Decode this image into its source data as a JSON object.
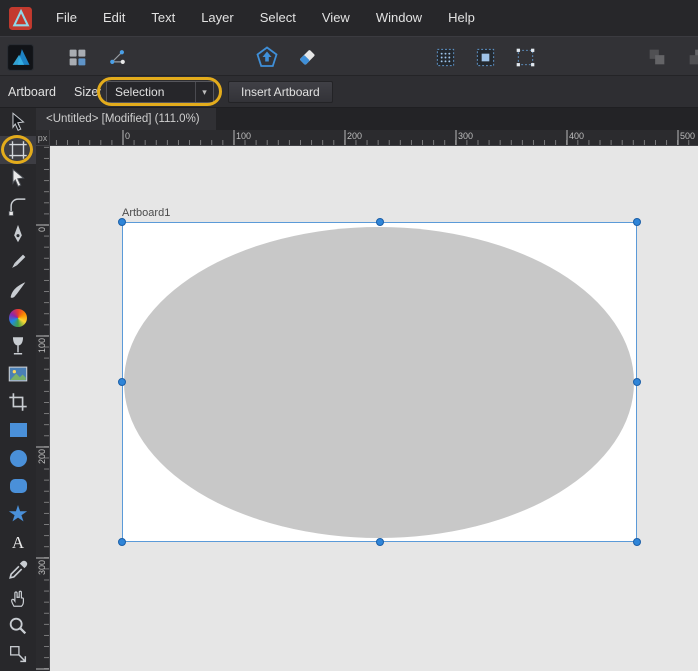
{
  "menu_bar": {
    "items": [
      "File",
      "Edit",
      "Text",
      "Layer",
      "Select",
      "View",
      "Window",
      "Help"
    ]
  },
  "toolbar": {
    "left_icons": [
      "grid-icon",
      "node-connections-icon"
    ],
    "logo_icon": "affinity-designer-logo",
    "center_icons": [
      "pentagon-upload-icon",
      "eraser-icon"
    ],
    "right_icons": [
      "snap-dots-icon",
      "snap-squares-icon",
      "snap-transform-icon"
    ],
    "far_right_disabled_icons": [
      "arrange-icon-1",
      "arrange-icon-2"
    ]
  },
  "context_toolbar": {
    "tool_label": "Artboard",
    "size_label": "Size:",
    "size_value": "Selection",
    "caret": "▼",
    "insert_artboard_label": "Insert Artboard"
  },
  "document": {
    "tab_title": "<Untitled> [Modified] (111.0%)",
    "artboard_name": "Artboard1"
  },
  "rulers": {
    "unit_label": "px",
    "horizontal_labels": [
      "0",
      "100",
      "200",
      "300",
      "400",
      "500"
    ],
    "vertical_labels": [
      "0",
      "100",
      "200",
      "300"
    ]
  },
  "tools": {
    "items": [
      "move-tool",
      "artboard-tool",
      "node-tool",
      "corner-tool",
      "pen-tool",
      "pencil-tool",
      "vector-brush-tool",
      "fill-tool",
      "transparency-tool",
      "place-image-tool",
      "vector-crop-tool",
      "rectangle-tool",
      "ellipse-tool",
      "rounded-rectangle-tool",
      "star-tool",
      "artistic-text-tool",
      "color-picker-tool",
      "view-tool",
      "zoom-tool",
      "point-transform-tool"
    ],
    "selected": "artboard-tool"
  },
  "annotations": {
    "highlighted_tool": "artboard-tool",
    "highlighted_control": "size-dropdown",
    "highlight_color": "#e3ac1c"
  },
  "colors": {
    "accent_blue": "#4a90d9",
    "selection_blue": "#2f85d8",
    "highlight_yellow": "#e3ac1c",
    "canvas_background": "#e6e6e6",
    "artboard_fill": "#ffffff",
    "ellipse_fill": "#c8c8c8"
  }
}
